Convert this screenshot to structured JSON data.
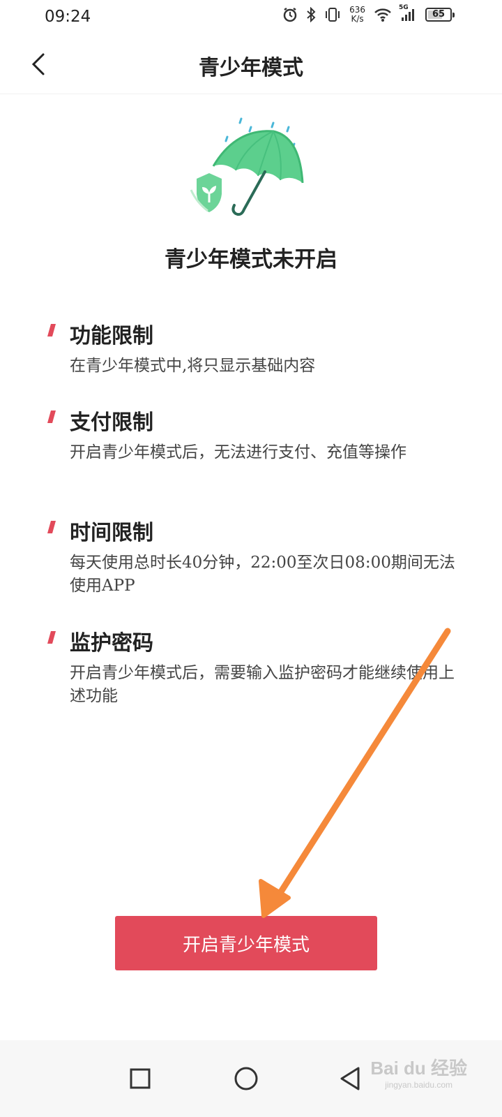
{
  "status_bar": {
    "time": "09:24",
    "net_speed_value": "636",
    "net_speed_unit": "K/s",
    "network": "5G",
    "battery": "65",
    "battery_level": 0.65,
    "icons": [
      "alarm-icon",
      "bluetooth-icon",
      "vibrate-icon",
      "wifi-icon",
      "signal-icon",
      "battery-icon"
    ]
  },
  "header": {
    "title": "青少年模式",
    "back_icon": "chevron-left-icon"
  },
  "hero": {
    "icon": "umbrella-shield-icon",
    "status_text": "青少年模式未开启"
  },
  "sections": [
    {
      "title": "功能限制",
      "desc": "在青少年模式中,将只显示基础内容"
    },
    {
      "title": "支付限制",
      "desc": "开启青少年模式后，无法进行支付、充值等操作"
    },
    {
      "title": "时间限制",
      "desc": "每天使用总时长40分钟，22:00至次日08:00期间无法使用APP"
    },
    {
      "title": "监护密码",
      "desc": "开启青少年模式后，需要输入监护密码才能继续使用上述功能"
    }
  ],
  "primary_button": {
    "label": "开启青少年模式"
  },
  "nav": {
    "icons": [
      "recent-apps-icon",
      "home-icon",
      "back-triangle-icon"
    ]
  },
  "watermark": {
    "brand": "Bai du 经验",
    "url": "jingyan.baidu.com"
  },
  "colors": {
    "accent": "#e24a5a",
    "umbrella": "#5ccf8d",
    "arrow": "#f5893a"
  }
}
